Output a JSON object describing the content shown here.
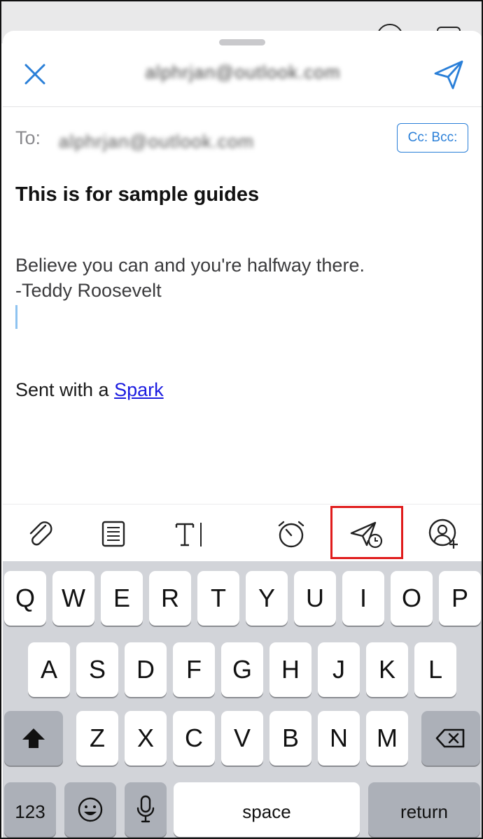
{
  "header": {
    "from_address": "alphrjan@outlook.com"
  },
  "recipients": {
    "to_label": "To:",
    "to_address": "alphrjan@outlook.com",
    "cc_bcc_label": "Cc: Bcc:"
  },
  "message": {
    "subject": "This is for sample guides",
    "body_line_1": "Believe you can and you're halfway there.",
    "body_line_2": "-Teddy Roosevelt",
    "signature_prefix": "Sent with a ",
    "signature_link": "Spark"
  },
  "toolbar": {
    "icons": [
      "paperclip-icon",
      "template-icon",
      "text-format-icon",
      "alarm-icon",
      "send-later-icon",
      "add-contact-icon"
    ],
    "highlighted": "send-later-icon",
    "highlight_color": "#e01b1b"
  },
  "keyboard": {
    "row1": [
      "Q",
      "W",
      "E",
      "R",
      "T",
      "Y",
      "U",
      "I",
      "O",
      "P"
    ],
    "row2": [
      "A",
      "S",
      "D",
      "F",
      "G",
      "H",
      "J",
      "K",
      "L"
    ],
    "row3": [
      "Z",
      "X",
      "C",
      "V",
      "B",
      "N",
      "M"
    ],
    "numbers_label": "123",
    "space_label": "space",
    "return_label": "return"
  },
  "colors": {
    "accent": "#2a7fd8",
    "link": "#1b1be0"
  }
}
